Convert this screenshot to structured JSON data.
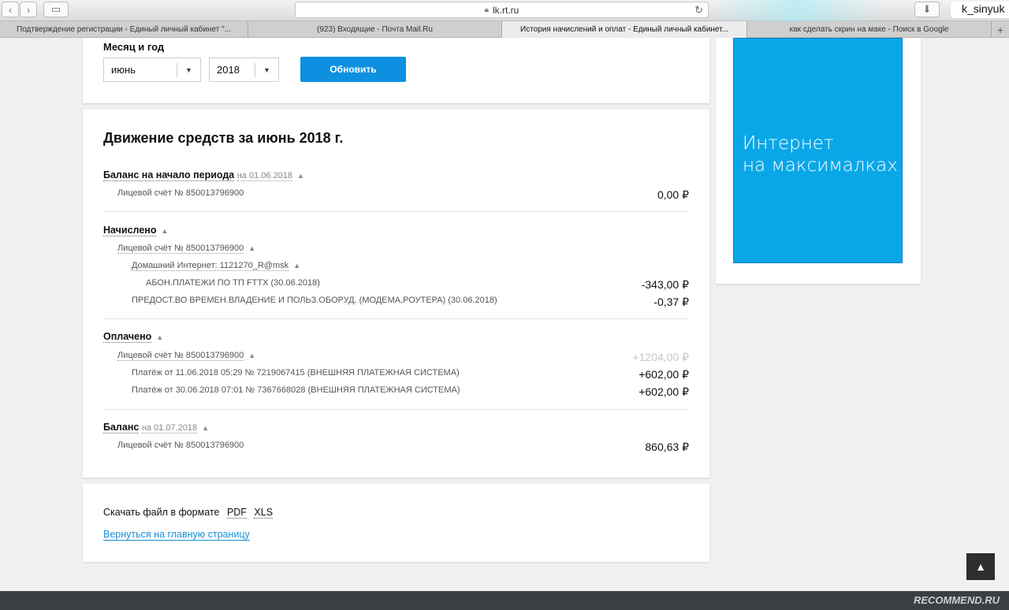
{
  "browser": {
    "address": "lk.rt.ru",
    "user": "k_sinyuk",
    "tabs": [
      "Подтверждение регистрации - Единый личный кабинет \"...",
      "(923) Входящие - Почта Mail.Ru",
      "История начислений и оплат - Единый личный кабинет...",
      "как сделать скрин на маке - Поиск в Google"
    ]
  },
  "filter": {
    "label": "Месяц и год",
    "month": "июнь",
    "year": "2018",
    "refresh": "Обновить"
  },
  "statement": {
    "title": "Движение средств за июнь 2018 г.",
    "opening": {
      "label": "Баланс на начало периода",
      "date": "на 01.06.2018",
      "account": "Лицевой счёт № 850013796900",
      "amount": "0,00 ₽"
    },
    "charged": {
      "label": "Начислено",
      "account": "Лицевой счёт № 850013796900",
      "service": "Домашний Интернет: 1121270_R@msk",
      "items": [
        {
          "name": "АБОН.ПЛАТЕЖИ ПО ТП FTTX (30.06.2018)",
          "amount": "-343,00 ₽"
        },
        {
          "name": "ПРЕДОСТ.ВО ВРЕМЕН.ВЛАДЕНИЕ И ПОЛЬЗ.ОБОРУД. (МОДЕМА,РОУТЕРА) (30.06.2018)",
          "amount": "-0,37 ₽"
        }
      ]
    },
    "paid": {
      "label": "Оплачено",
      "account": "Лицевой счёт № 850013796900",
      "total": "+1204,00 ₽",
      "items": [
        {
          "name": "Платёж от 11.06.2018 05:29 № 7219067415 (ВНЕШНЯЯ ПЛАТЕЖНАЯ СИСТЕМА)",
          "amount": "+602,00 ₽"
        },
        {
          "name": "Платёж от 30.06.2018 07:01 № 7367668028 (ВНЕШНЯЯ ПЛАТЕЖНАЯ СИСТЕМА)",
          "amount": "+602,00 ₽"
        }
      ]
    },
    "closing": {
      "label": "Баланс",
      "date": "на 01.07.2018",
      "account": "Лицевой счёт № 850013796900",
      "amount": "860,63 ₽"
    }
  },
  "download": {
    "text": "Скачать файл в формате",
    "pdf": "PDF",
    "xls": "XLS",
    "back": "Вернуться на главную страницу"
  },
  "ad": {
    "line1": "Интернет",
    "line2": "на максималках"
  },
  "watermark": "RECOMMEND.RU",
  "colors": {
    "accent": "#0e90e0",
    "ad_background": "#0aa7e8",
    "link": "#1a8fd7"
  }
}
